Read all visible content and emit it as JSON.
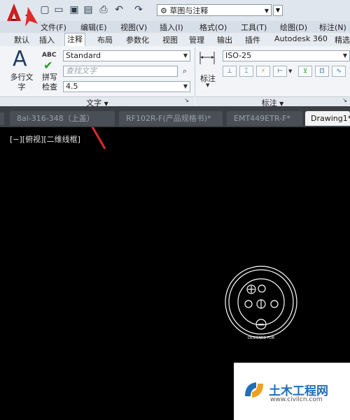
{
  "quick_access": {
    "workspace": "草图与注释",
    "icons": [
      "new-icon",
      "open-icon",
      "save-icon",
      "save-as-icon",
      "print-icon",
      "undo-icon",
      "redo-icon",
      "gear-icon"
    ]
  },
  "menubar": {
    "items": [
      "文件(F)",
      "编辑(E)",
      "视图(V)",
      "插入(I)",
      "格式(O)",
      "工具(T)",
      "绘图(D)",
      "标注(N)"
    ]
  },
  "ribbon_tabs": {
    "items": [
      "默认",
      "插入",
      "注释",
      "布局",
      "参数化",
      "视图",
      "管理",
      "输出",
      "插件",
      "Autodesk 360",
      "精选"
    ],
    "active": "注释"
  },
  "text_panel": {
    "multiline_text": "多行文字",
    "spell_check": "拼写检查",
    "abc_label": "ABC",
    "style": "Standard",
    "find_placeholder": "查找文字",
    "height": "4.5",
    "title": "文字"
  },
  "dim_panel": {
    "dimension_label": "标注",
    "style": "ISO-25",
    "title": "标注"
  },
  "doc_tabs": {
    "items": [
      "8al-316-348（上盖）",
      "RF102R-F(产品规格书)*",
      "EMT449ETR-F*",
      "Drawing1*"
    ],
    "active": "Drawing1*"
  },
  "viewport": {
    "label": "[−][俯视][二维线框]"
  },
  "drawing": {
    "ring_text": "DESIGNED FOR"
  },
  "watermark": {
    "name": "土木工程网",
    "url": "www.civilcn.com"
  },
  "colors": {
    "accent_red": "#cc1f1f",
    "arrow": "#e12a2a",
    "wm_blue": "#1f6fb5"
  }
}
